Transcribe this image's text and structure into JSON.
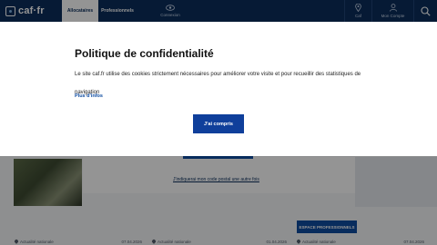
{
  "header": {
    "logo_text": "caf·fr",
    "tabs": [
      {
        "label": "Allocataires",
        "active": true
      },
      {
        "label": "Professionnels",
        "active": false
      }
    ],
    "connect_label": "Connexion",
    "caf_label": "Caf",
    "account_label": "Mon Compte",
    "colors": {
      "navy": "#0b2e5c"
    }
  },
  "background": {
    "postal_link": "J'indiquerai mon code postal une autre fois",
    "pro_button": "ESPACE PROFESSIONNELS",
    "cards": [
      {
        "label": "Actualité nationale",
        "date": "07.04.2026"
      },
      {
        "label": "Actualité nationale",
        "date": "01.04.2026"
      },
      {
        "label": "Actualité nationale",
        "date": "07.04.2026"
      }
    ]
  },
  "cookie": {
    "title": "Politique de confidentialité",
    "text": "Le site caf.fr utilise des cookies strictement nécessaires pour améliorer votre visite et pour recueillir des statistiques de navigation",
    "more_link": "Plus d'infos",
    "accept_label": "J'ai compris",
    "accent": "#0f3f9b"
  }
}
